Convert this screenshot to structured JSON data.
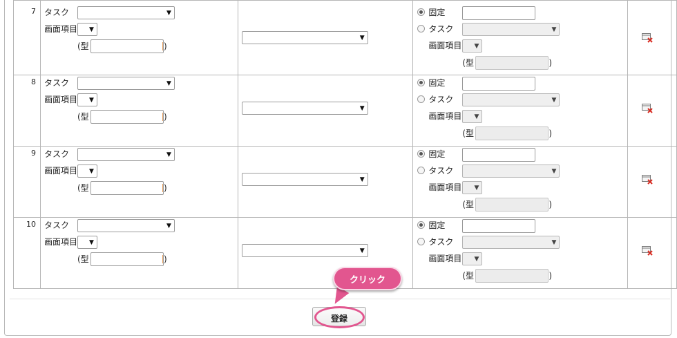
{
  "rows": [
    {
      "num": "7",
      "task_label": "タスク",
      "item_label": "画面項目",
      "type_open": "(型",
      "type_close": ")",
      "fixed_label": "固定",
      "task_label_right": "タスク",
      "item_label_right": "画面項目",
      "type_open_right": "(型",
      "type_close_right": ")"
    },
    {
      "num": "8",
      "task_label": "タスク",
      "item_label": "画面項目",
      "type_open": "(型",
      "type_close": ")",
      "fixed_label": "固定",
      "task_label_right": "タスク",
      "item_label_right": "画面項目",
      "type_open_right": "(型",
      "type_close_right": ")"
    },
    {
      "num": "9",
      "task_label": "タスク",
      "item_label": "画面項目",
      "type_open": "(型",
      "type_close": ")",
      "fixed_label": "固定",
      "task_label_right": "タスク",
      "item_label_right": "画面項目",
      "type_open_right": "(型",
      "type_close_right": ")"
    },
    {
      "num": "10",
      "task_label": "タスク",
      "item_label": "画面項目",
      "type_open": "(型",
      "type_close": ")",
      "fixed_label": "固定",
      "task_label_right": "タスク",
      "item_label_right": "画面項目",
      "type_open_right": "(型",
      "type_close_right": ")"
    }
  ],
  "arrow_glyph": "▼",
  "register_button": "登録",
  "callout": "クリック",
  "colors": {
    "callout": "#e2568f",
    "border": "#b5b5b5"
  },
  "icons": {
    "delete": "delete-row-icon"
  }
}
